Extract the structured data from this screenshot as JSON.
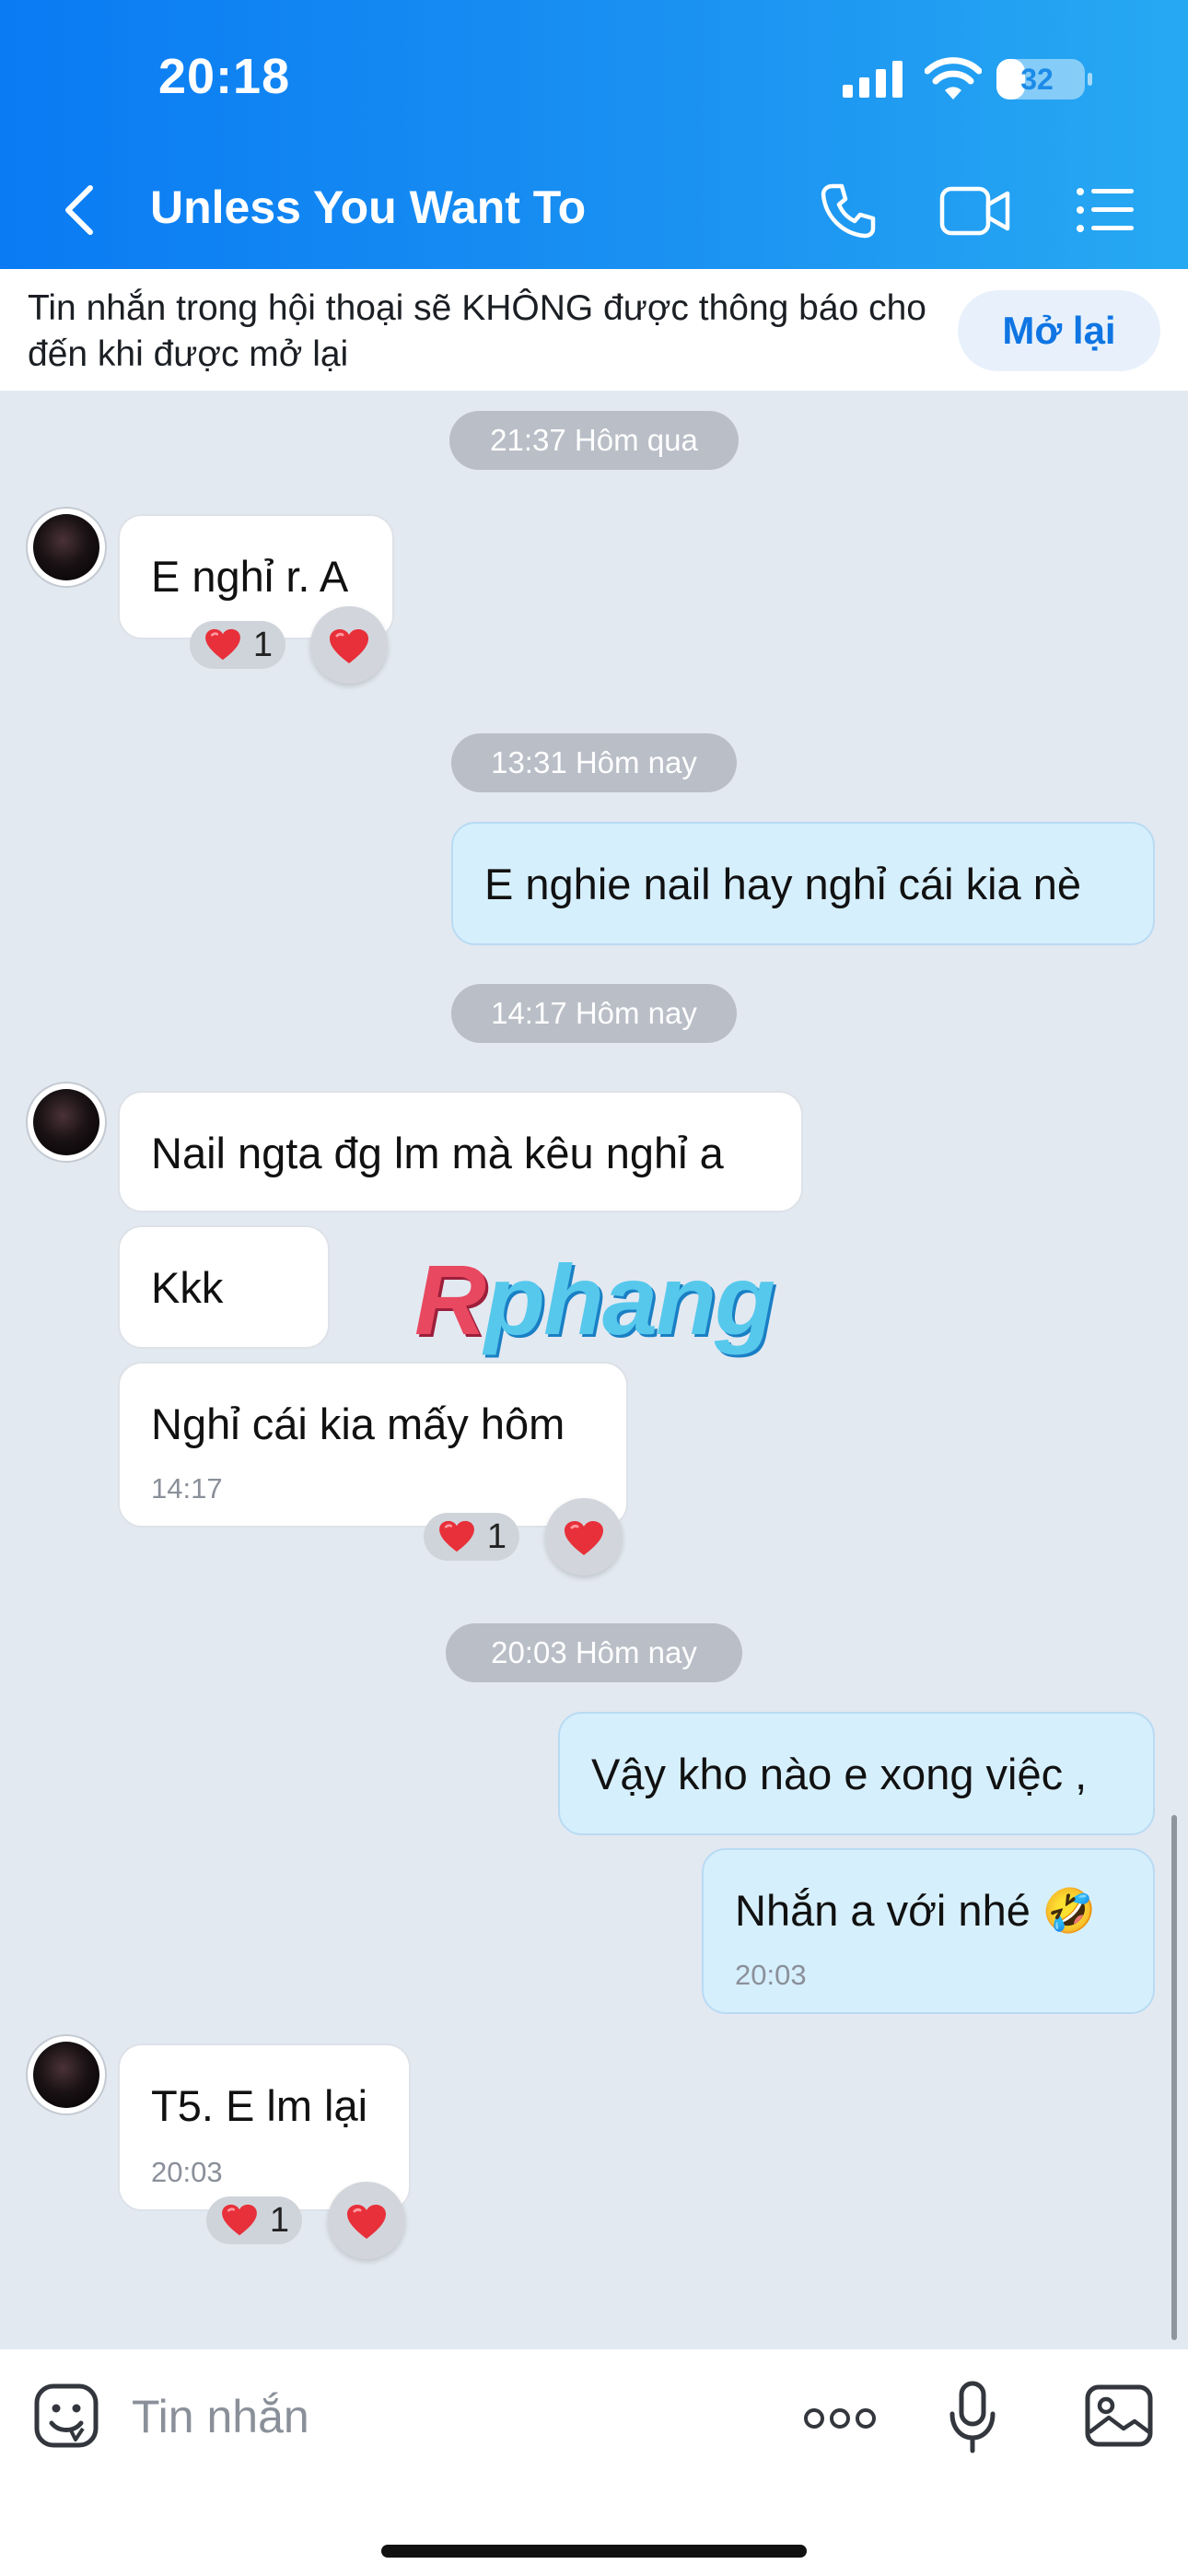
{
  "status_bar": {
    "time": "20:18",
    "battery": "32",
    "battery_level_percent": 32
  },
  "header": {
    "title": "Unless You Want To",
    "back_icon": "chevron-left-icon",
    "actions": [
      "phone-icon",
      "video-call-icon",
      "list-menu-icon"
    ]
  },
  "banner": {
    "text": "Tin nhắn trong hội thoại sẽ KHÔNG được thông báo cho đến khi được mở lại",
    "button": "Mở lại"
  },
  "messages": {
    "stamp1": "21:37 Hôm qua",
    "m1": {
      "text": "E nghỉ r. A",
      "reaction_count": "1"
    },
    "stamp2": "13:31 Hôm nay",
    "m2": {
      "text": "E nghie nail hay nghỉ cái kia nè"
    },
    "stamp3": "14:17 Hôm nay",
    "m3": {
      "text": "Nail ngta đg lm mà kêu nghỉ a"
    },
    "m4": {
      "text": "Kkk"
    },
    "m5": {
      "text": "Nghỉ cái kia mấy hôm",
      "time": "14:17",
      "reaction_count": "1"
    },
    "stamp4": "20:03 Hôm nay",
    "m6": {
      "text": "Vậy kho nào e xong việc ,"
    },
    "m7": {
      "text": "Nhắn a với nhé 🤣",
      "time": "20:03"
    },
    "m8": {
      "text": "T5. E lm lại",
      "time": "20:03",
      "reaction_count": "1"
    }
  },
  "watermark": {
    "first": "R",
    "rest": "phang"
  },
  "input_bar": {
    "placeholder": "Tin nhắn",
    "icons": [
      "sticker-icon",
      "more-icon",
      "microphone-icon",
      "image-icon"
    ]
  },
  "colors": {
    "header_start": "#0a7bf3",
    "header_end": "#27a9f2",
    "outgoing_bubble": "#d6effd",
    "incoming_bubble": "#ffffff",
    "chat_background": "#e3e9f1",
    "heart": "#e8303a"
  }
}
